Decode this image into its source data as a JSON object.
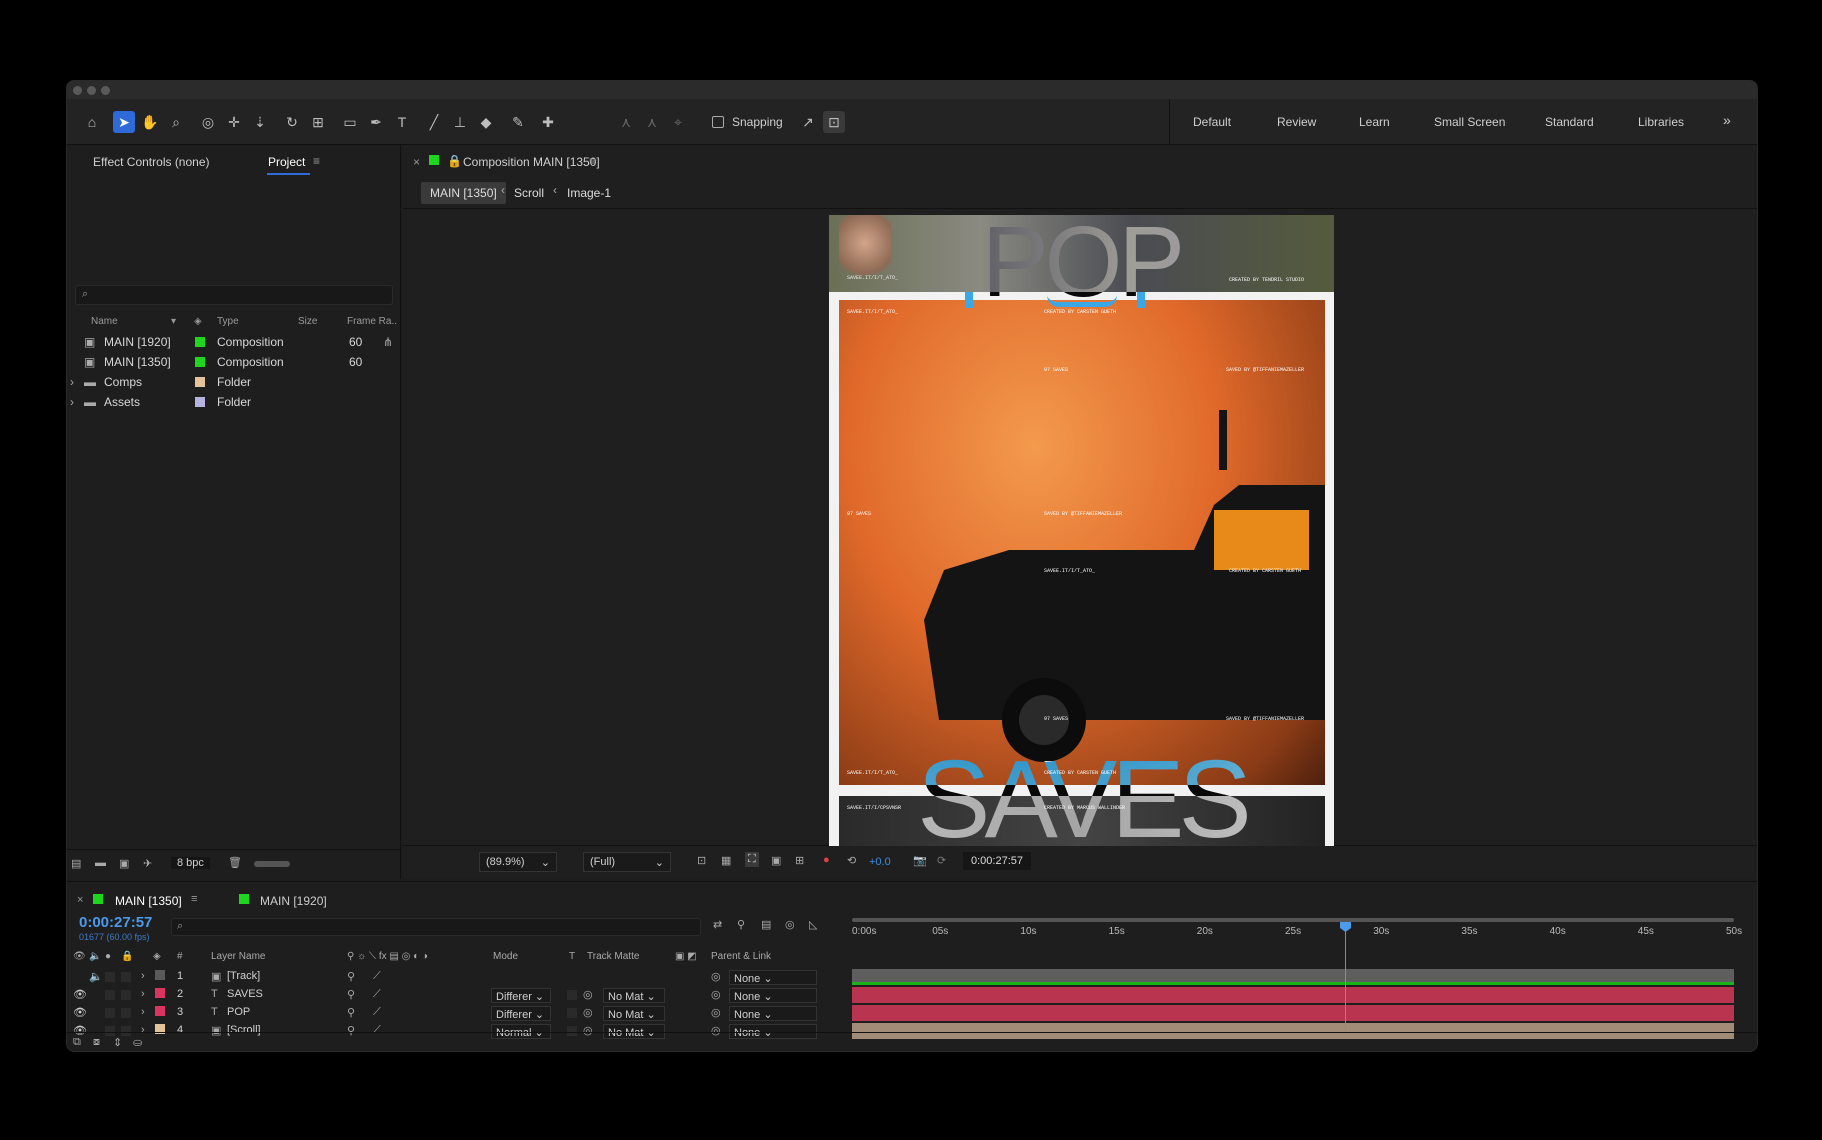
{
  "toolbar": {
    "snapping_label": "Snapping",
    "workspaces": [
      "Default",
      "Review",
      "Learn",
      "Small Screen",
      "Standard",
      "Libraries"
    ]
  },
  "left_panel": {
    "tab_effect": "Effect Controls (none)",
    "tab_project": "Project",
    "columns": {
      "name": "Name",
      "type": "Type",
      "size": "Size",
      "frame_rate": "Frame Ra.."
    },
    "items": [
      {
        "name": "MAIN [1920]",
        "type": "Composition",
        "fps": "60",
        "color": "#1fd61f"
      },
      {
        "name": "MAIN [1350]",
        "type": "Composition",
        "fps": "60",
        "color": "#1fd61f"
      },
      {
        "name": "Comps",
        "type": "Folder",
        "fps": "",
        "color": "#e4c29a"
      },
      {
        "name": "Assets",
        "type": "Folder",
        "fps": "",
        "color": "#b7b3e0"
      }
    ],
    "bpc": "8 bpc"
  },
  "comp_panel": {
    "tab_title": "Composition MAIN [1350]",
    "breadcrumbs": [
      "MAIN [1350]",
      "Scroll",
      "Image-1"
    ],
    "zoom": "(89.9%)",
    "resolution": "(Full)",
    "exposure": "+0.0",
    "timecode": "0:00:27:57"
  },
  "artwork": {
    "pop": "POP",
    "saves": "SAVES",
    "small": {
      "t1": "SAVEE.IT/I/T_ATO_",
      "t2": "CREATED BY CARSTEN GUETH",
      "t3": "97 SAVES",
      "t4": "SAVED BY @TIFFANIEMAZELLER",
      "t5": "CREATED BY TENDRIL STUDIO",
      "t6": "SAVEE.IT/I/CPSVNSR",
      "t7": "CREATED BY MARCUS WALLINDER"
    }
  },
  "timeline": {
    "tab_active": "MAIN [1350]",
    "tab_other": "MAIN [1920]",
    "timecode": "0:00:27:57",
    "frame_info": "01677 (60.00 fps)",
    "headers": {
      "layer_name": "Layer Name",
      "mode": "Mode",
      "t": "T",
      "track_matte": "Track Matte",
      "parent": "Parent & Link",
      "num": "#"
    },
    "ruler": [
      "0:00s",
      "05s",
      "10s",
      "15s",
      "20s",
      "25s",
      "30s",
      "35s",
      "40s",
      "45s",
      "50s"
    ],
    "playhead_seconds": 27.95,
    "duration_seconds": 50,
    "layers": [
      {
        "num": "1",
        "name": "[Track]",
        "mode": "",
        "matte": "",
        "parent": "None",
        "color": "#5a5a5a"
      },
      {
        "num": "2",
        "name": "SAVES",
        "mode": "Differer",
        "matte": "No Mat",
        "parent": "None",
        "color": "#d9355e"
      },
      {
        "num": "3",
        "name": "POP",
        "mode": "Differer",
        "matte": "No Mat",
        "parent": "None",
        "color": "#d9355e"
      },
      {
        "num": "4",
        "name": "[Scroll]",
        "mode": "Normal",
        "matte": "No Mat",
        "parent": "None",
        "color": "#e4c29a"
      }
    ]
  }
}
